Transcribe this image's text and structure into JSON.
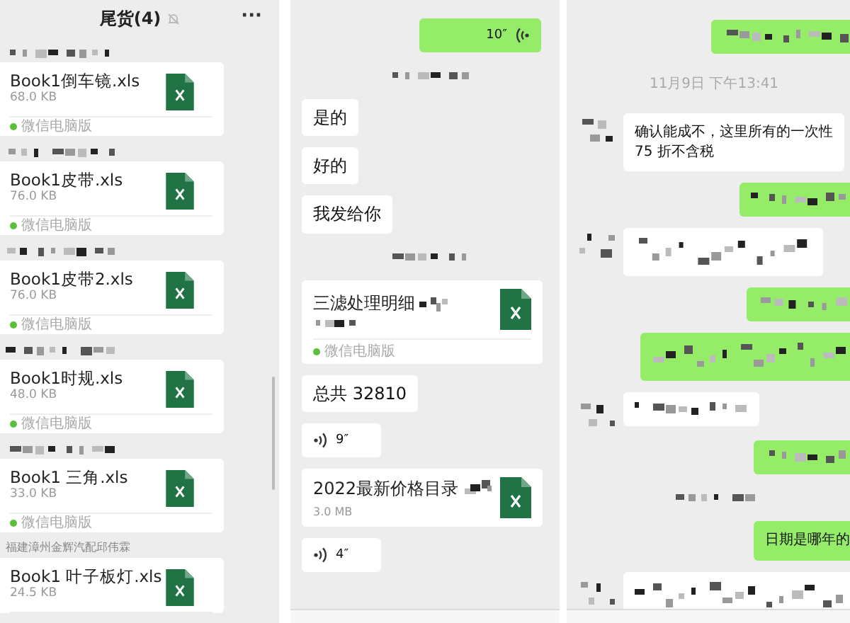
{
  "file_list": {
    "title": "尾货(4)",
    "muted": true,
    "menu": "···",
    "items": [
      {
        "name": "Book1倒车镜.xls",
        "size": "68.0 KB",
        "source": "微信电脑版"
      },
      {
        "name": "Book1皮带.xls",
        "size": "76.0 KB",
        "source": "微信电脑版"
      },
      {
        "name": "Book1皮带2.xls",
        "size": "76.0 KB",
        "source": "微信电脑版"
      },
      {
        "name": "Book1时规.xls",
        "size": "48.0 KB",
        "source": "微信电脑版"
      },
      {
        "name": "Book1 三角.xls",
        "size": "33.0 KB",
        "source": "微信电脑版"
      },
      {
        "sender": "福建漳州金辉汽配邱伟霖",
        "name": "Book1 叶子板灯.xls",
        "size": "24.5 KB"
      }
    ]
  },
  "chats": [
    {
      "messages": [
        {
          "kind": "voice",
          "outgoing": true,
          "duration": "10″"
        },
        {
          "kind": "hidden_time"
        },
        {
          "kind": "text",
          "outgoing": false,
          "text": "是的"
        },
        {
          "kind": "text",
          "outgoing": false,
          "text": "好的"
        },
        {
          "kind": "text",
          "outgoing": false,
          "text": "我发给你"
        },
        {
          "kind": "hidden_time"
        },
        {
          "kind": "file",
          "outgoing": false,
          "name": "三滤处理明细",
          "source": "微信电脑版"
        },
        {
          "kind": "text",
          "outgoing": false,
          "text": "总共 32810"
        },
        {
          "kind": "voice",
          "outgoing": false,
          "duration": "9″"
        },
        {
          "kind": "file",
          "outgoing": false,
          "name": "2022最新价格目录",
          "size": "3.0 MB"
        },
        {
          "kind": "voice",
          "outgoing": false,
          "duration": "4″"
        }
      ]
    },
    {
      "messages": [
        {
          "kind": "hidden",
          "outgoing": true
        },
        {
          "kind": "time",
          "text": "11月9日 下午13:41"
        },
        {
          "kind": "text",
          "outgoing": false,
          "avatar": true,
          "text": "确认能成不，这里所有的一次性\n75 折不含税"
        },
        {
          "kind": "hidden",
          "outgoing": true
        },
        {
          "kind": "hidden",
          "outgoing": false,
          "avatar": true
        },
        {
          "kind": "hidden",
          "outgoing": true
        },
        {
          "kind": "hidden",
          "outgoing": true
        },
        {
          "kind": "hidden",
          "outgoing": false,
          "avatar": true
        },
        {
          "kind": "hidden",
          "outgoing": true
        },
        {
          "kind": "hidden_time"
        },
        {
          "kind": "text",
          "outgoing": true,
          "text": "日期是哪年的"
        },
        {
          "kind": "hidden",
          "outgoing": false,
          "avatar": true
        }
      ]
    }
  ]
}
